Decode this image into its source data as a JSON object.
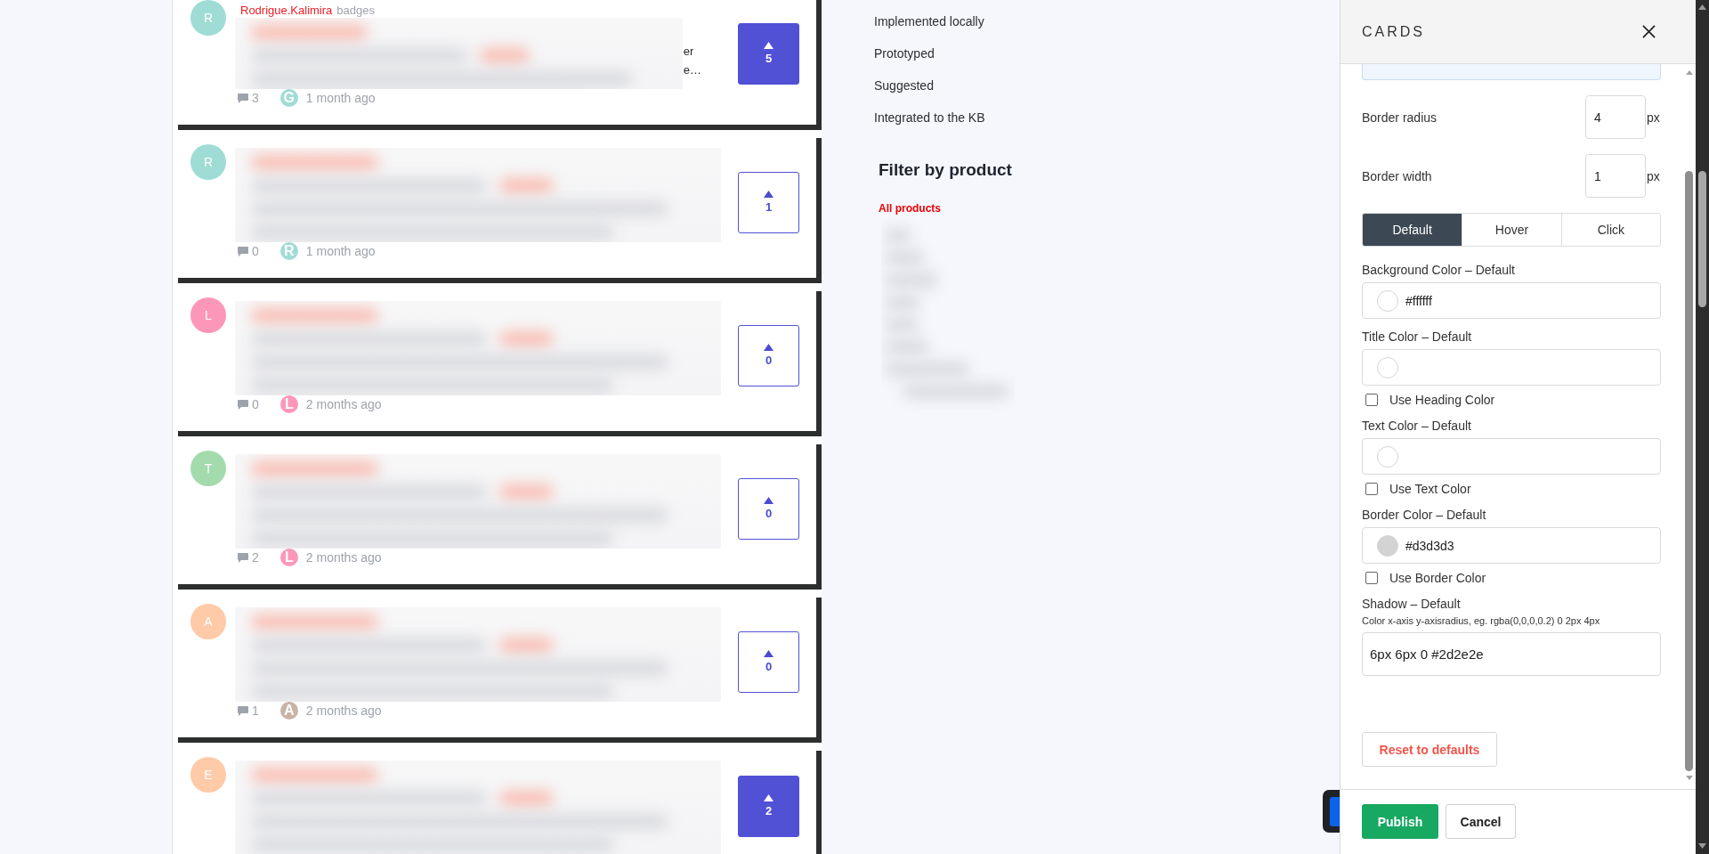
{
  "cards": [
    {
      "avatar": {
        "letter": "R",
        "color": "#9fdcd5"
      },
      "author": "Rodrigue.Kalimira",
      "author_note": "badges",
      "excerpt_fragments": [
        "er",
        "e…"
      ],
      "comments": "3",
      "commenter": {
        "letter": "G",
        "color": "#9fdcd5"
      },
      "time": "1 month ago",
      "votes": "5",
      "voted": true
    },
    {
      "avatar": {
        "letter": "R",
        "color": "#9fdcd5"
      },
      "comments": "0",
      "commenter": {
        "letter": "R",
        "color": "#9fdcd5"
      },
      "time": "1 month ago",
      "votes": "1",
      "voted": false
    },
    {
      "avatar": {
        "letter": "L",
        "color": "#fd97ba"
      },
      "comments": "0",
      "commenter": {
        "letter": "L",
        "color": "#fd97ba"
      },
      "time": "2 months ago",
      "votes": "0",
      "voted": false
    },
    {
      "avatar": {
        "letter": "T",
        "color": "#a3dbad"
      },
      "comments": "2",
      "commenter": {
        "letter": "L",
        "color": "#fd97ba"
      },
      "time": "2 months ago",
      "votes": "0",
      "voted": false
    },
    {
      "avatar": {
        "letter": "A",
        "color": "#fecaa8"
      },
      "comments": "1",
      "commenter": {
        "letter": "A",
        "color": "#c9b2a6"
      },
      "time": "2 months ago",
      "votes": "0",
      "voted": false
    },
    {
      "avatar": {
        "letter": "E",
        "color": "#fecaa8"
      },
      "votes": "2",
      "voted": true
    }
  ],
  "status_filters": [
    {
      "label": "Implemented locally",
      "selected": false
    },
    {
      "label": "Prototyped",
      "selected": false
    },
    {
      "label": "Suggested",
      "selected": false
    },
    {
      "label": "Integrated to the KB",
      "selected": false
    }
  ],
  "product_filter": {
    "title": "Filter by product",
    "items": [
      {
        "label": "All products",
        "selected": true
      }
    ]
  },
  "panel": {
    "title": "CARDS",
    "number_fields": [
      {
        "label": "Border radius",
        "value": "4",
        "unit": "px"
      },
      {
        "label": "Border width",
        "value": "1",
        "unit": "px"
      }
    ],
    "tabs": [
      {
        "label": "Default",
        "selected": true
      },
      {
        "label": "Hover",
        "selected": false
      },
      {
        "label": "Click",
        "selected": false
      }
    ],
    "color_fields": [
      {
        "label": "Background Color – Default",
        "value": "#ffffff",
        "color": "#ffffff"
      },
      {
        "label": "Title Color – Default",
        "checkbox": {
          "label": "Use Heading Color",
          "checked": false
        }
      },
      {
        "label": "Text Color – Default",
        "checkbox": {
          "label": "Use Text Color",
          "checked": false
        }
      },
      {
        "label": "Border Color – Default",
        "value": "#d3d3d3",
        "color": "#d3d3d3",
        "checkbox": {
          "label": "Use Border Color",
          "checked": false
        }
      }
    ],
    "shadow": {
      "label": "Shadow – Default",
      "hint": "Color x-axis y-axisradius, eg. rgba(0,0,0,0.2) 0 2px 4px",
      "value": "6px 6px 0 #2d2e2e"
    },
    "reset_button": "Reset to defaults",
    "footer_buttons": [
      {
        "label": "Publish",
        "kind": "primary"
      },
      {
        "label": "Cancel",
        "kind": "secondary"
      }
    ]
  }
}
